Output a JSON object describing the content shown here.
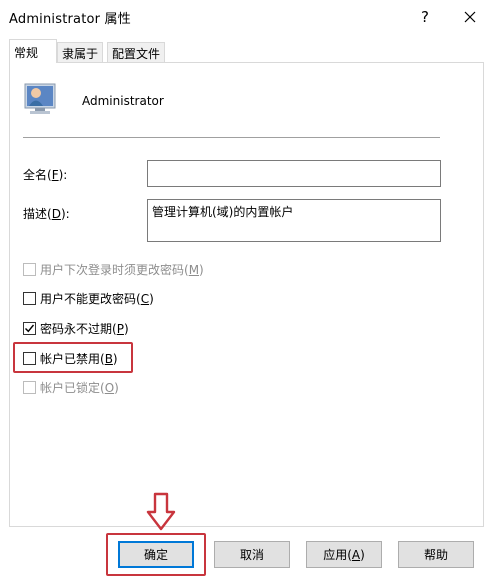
{
  "window": {
    "title": "Administrator 属性",
    "help_glyph": "?",
    "close_glyph": "×"
  },
  "tabs": [
    {
      "label": "常规",
      "active": true
    },
    {
      "label": "隶属于",
      "active": false
    },
    {
      "label": "配置文件",
      "active": false
    }
  ],
  "general": {
    "user_name": "Administrator",
    "full_name": {
      "label": "全名(",
      "accel": "F",
      "suffix": "):",
      "value": ""
    },
    "description": {
      "label": "描述(",
      "accel": "D",
      "suffix": "):",
      "value": "管理计算机(域)的内置帐户"
    },
    "checkboxes": [
      {
        "label": "用户下次登录时须更改密码(",
        "accel": "M",
        "suffix": ")",
        "checked": false,
        "enabled": false
      },
      {
        "label": "用户不能更改密码(",
        "accel": "C",
        "suffix": ")",
        "checked": false,
        "enabled": true
      },
      {
        "label": "密码永不过期(",
        "accel": "P",
        "suffix": ")",
        "checked": true,
        "enabled": true
      },
      {
        "label": "帐户已禁用(",
        "accel": "B",
        "suffix": ")",
        "checked": false,
        "enabled": true
      },
      {
        "label": "帐户已锁定(",
        "accel": "O",
        "suffix": ")",
        "checked": false,
        "enabled": false
      }
    ]
  },
  "buttons": {
    "ok": "确定",
    "cancel": "取消",
    "apply_label": "应用(",
    "apply_accel": "A",
    "apply_suffix": ")",
    "help": "帮助"
  },
  "colors": {
    "highlight": "#c8353d",
    "focus": "#0078d7"
  }
}
